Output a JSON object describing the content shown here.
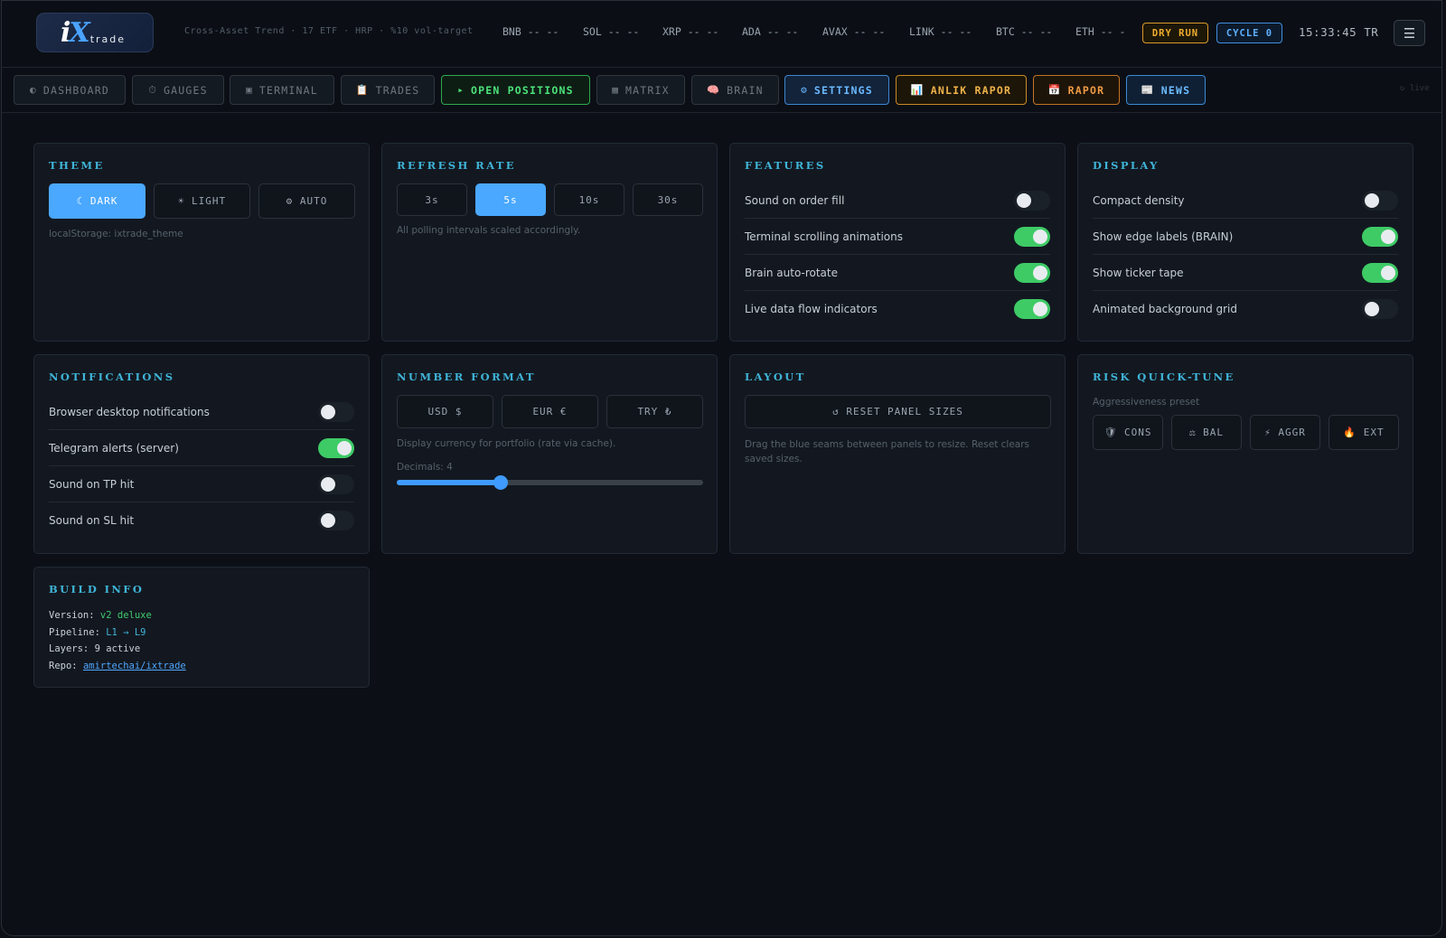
{
  "header": {
    "logo_main": "iX",
    "logo_sub": "trade",
    "subtitle": "Cross-Asset Trend · 17 ETF · HRP · %10 vol-target",
    "tickers": [
      {
        "symbol": "BNB",
        "value": "-- --"
      },
      {
        "symbol": "SOL",
        "value": "-- --"
      },
      {
        "symbol": "XRP",
        "value": "-- --"
      },
      {
        "symbol": "ADA",
        "value": "-- --"
      },
      {
        "symbol": "AVAX",
        "value": "-- --"
      },
      {
        "symbol": "LINK",
        "value": "-- --"
      },
      {
        "symbol": "BTC",
        "value": "-- --"
      },
      {
        "symbol": "ETH",
        "value": "-- -"
      }
    ],
    "dry_run": "DRY RUN",
    "cycle": "CYCLE 0",
    "clock": "15:33:45 TR",
    "menu_icon": "hamburger-icon"
  },
  "nav": {
    "tabs": [
      {
        "icon": "◐",
        "label": "DASHBOARD"
      },
      {
        "icon": "⏱",
        "label": "GAUGES"
      },
      {
        "icon": "▣",
        "label": "TERMINAL"
      },
      {
        "icon": "📋",
        "label": "TRADES"
      },
      {
        "icon": "▸",
        "label": "OPEN POSITIONS"
      },
      {
        "icon": "▦",
        "label": "MATRIX"
      },
      {
        "icon": "🧠",
        "label": "BRAIN"
      },
      {
        "icon": "⚙",
        "label": "SETTINGS"
      },
      {
        "icon": "📊",
        "label": "ANLIK RAPOR"
      },
      {
        "icon": "📅",
        "label": "RAPOR"
      },
      {
        "icon": "📰",
        "label": "NEWS"
      }
    ],
    "live": "↻ live",
    "active_tab": "SETTINGS"
  },
  "theme": {
    "title": "THEME",
    "options": [
      "☾ DARK",
      "☀ LIGHT",
      "⚙ AUTO"
    ],
    "selected": "DARK",
    "hint": "localStorage: ixtrade_theme"
  },
  "refresh": {
    "title": "REFRESH RATE",
    "options": [
      "3s",
      "5s",
      "10s",
      "30s"
    ],
    "selected": "5s",
    "hint": "All polling intervals scaled accordingly."
  },
  "features": {
    "title": "FEATURES",
    "items": [
      {
        "label": "Sound on order fill",
        "on": false
      },
      {
        "label": "Terminal scrolling animations",
        "on": true
      },
      {
        "label": "Brain auto-rotate",
        "on": true
      },
      {
        "label": "Live data flow indicators",
        "on": true
      }
    ]
  },
  "display": {
    "title": "DISPLAY",
    "items": [
      {
        "label": "Compact density",
        "on": false
      },
      {
        "label": "Show edge labels (BRAIN)",
        "on": true
      },
      {
        "label": "Show ticker tape",
        "on": true
      },
      {
        "label": "Animated background grid",
        "on": false
      }
    ]
  },
  "notifications": {
    "title": "NOTIFICATIONS",
    "items": [
      {
        "label": "Browser desktop notifications",
        "on": false
      },
      {
        "label": "Telegram alerts (server)",
        "on": true
      },
      {
        "label": "Sound on TP hit",
        "on": false
      },
      {
        "label": "Sound on SL hit",
        "on": false
      }
    ]
  },
  "number_format": {
    "title": "NUMBER FORMAT",
    "options": [
      "USD $",
      "EUR €",
      "TRY ₺"
    ],
    "hint": "Display currency for portfolio (rate via cache).",
    "decimals_label": "Decimals: 4",
    "decimals_value": 4,
    "decimals_fraction": 0.34
  },
  "layout": {
    "title": "LAYOUT",
    "reset_button": "↺ RESET PANEL SIZES",
    "hint": "Drag the blue seams between panels to resize. Reset clears saved sizes."
  },
  "risk": {
    "title": "RISK QUICK-TUNE",
    "hint": "Aggressiveness preset",
    "options": [
      "🛡 CONS",
      "⚖ BAL",
      "⚡ AGGR",
      "🔥 EXT"
    ]
  },
  "build": {
    "title": "BUILD INFO",
    "version_label": "Version:",
    "version": "v2 deluxe",
    "pipeline_label": "Pipeline:",
    "pipeline": "L1 → L9",
    "layers_label": "Layers:",
    "layers": "9 active",
    "repo_label": "Repo:",
    "repo": "amirtechai/ixtrade"
  },
  "colors": {
    "accent_blue": "#4aa8ff",
    "toggle_on": "#3ecb66",
    "title_cyan": "#3fb4d8",
    "dry_run": "#f0ad2e"
  }
}
